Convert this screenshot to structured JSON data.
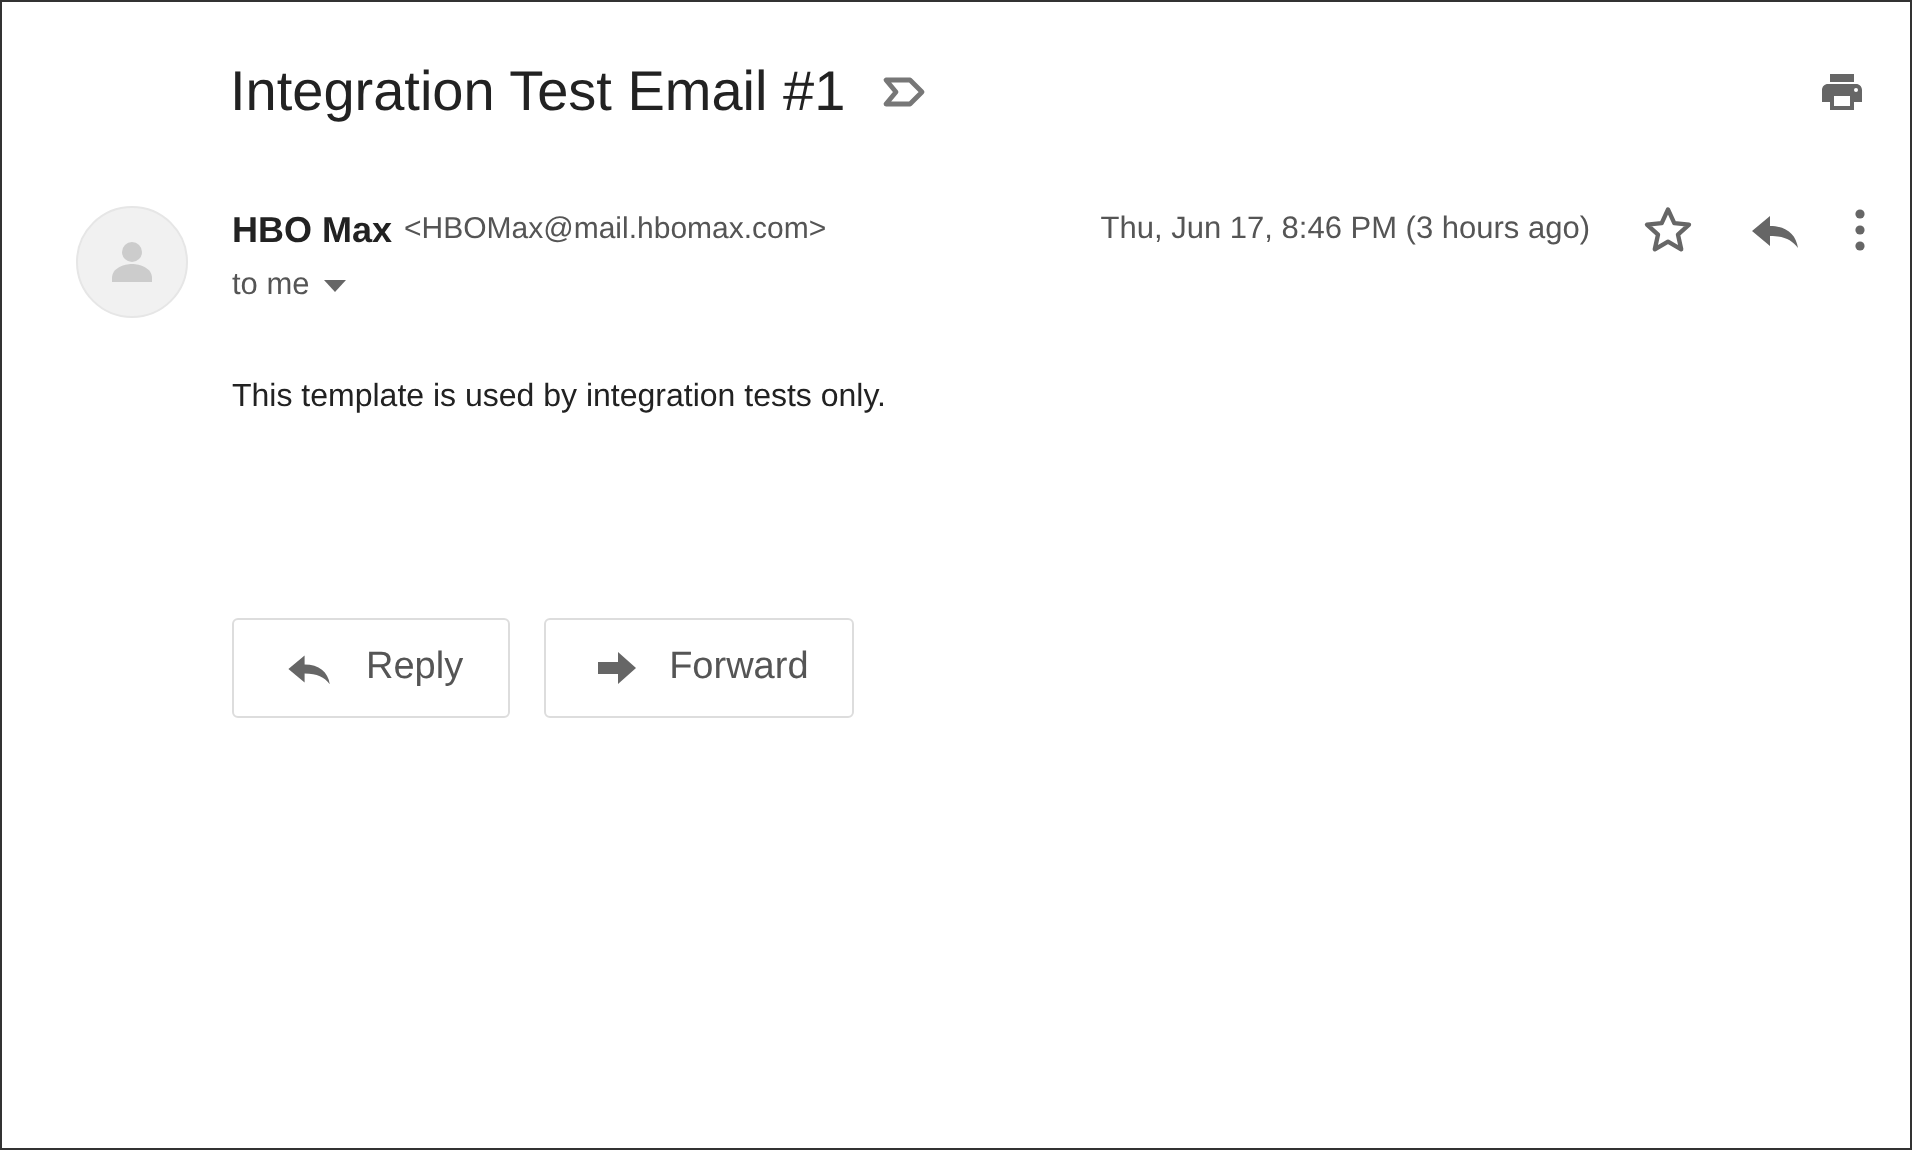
{
  "subject": "Integration Test Email #1",
  "message": {
    "sender_name": "HBO Max",
    "sender_email": "<HBOMax@mail.hbomax.com>",
    "recipient": "to me",
    "date": "Thu, Jun 17, 8:46 PM (3 hours ago)",
    "starred": false,
    "body": "This template is used by integration tests only."
  },
  "actions": [
    {
      "kind": "reply",
      "label": "Reply"
    },
    {
      "kind": "forward",
      "label": "Forward"
    }
  ]
}
